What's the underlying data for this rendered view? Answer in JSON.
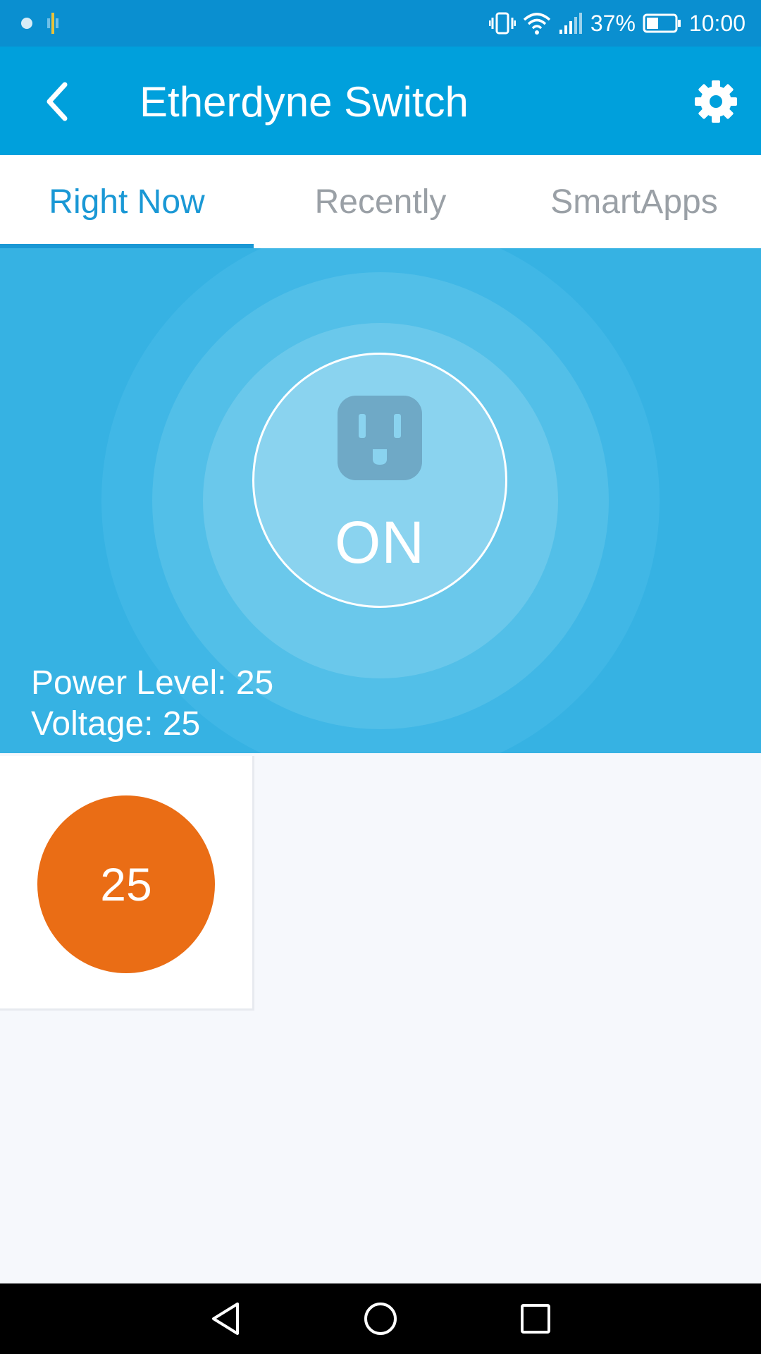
{
  "status_bar": {
    "battery": "37%",
    "time": "10:00",
    "icons": [
      "notification-dot-icon",
      "notification-app-icon",
      "vibrate-icon",
      "wifi-icon",
      "signal-icon",
      "battery-icon"
    ]
  },
  "app_bar": {
    "title": "Etherdyne Switch",
    "back_icon": "back-arrow-icon",
    "settings_icon": "gear-icon"
  },
  "tabs": [
    {
      "label": "Right Now",
      "active": true
    },
    {
      "label": "Recently",
      "active": false
    },
    {
      "label": "SmartApps",
      "active": false
    }
  ],
  "device": {
    "state": "ON",
    "icon": "outlet-icon",
    "power_level_text": "Power Level: 25",
    "voltage_text": "Voltage: 25"
  },
  "tile": {
    "value": "25"
  },
  "nav_bar": {
    "icons": [
      "nav-back-icon",
      "nav-home-icon",
      "nav-recents-icon"
    ]
  },
  "colors": {
    "status_bar": "#0a8fd0",
    "app_bar": "#00a0dc",
    "accent": "#1a98d5",
    "hero": "#36b2e3",
    "tile_value": "#ea6d15"
  }
}
